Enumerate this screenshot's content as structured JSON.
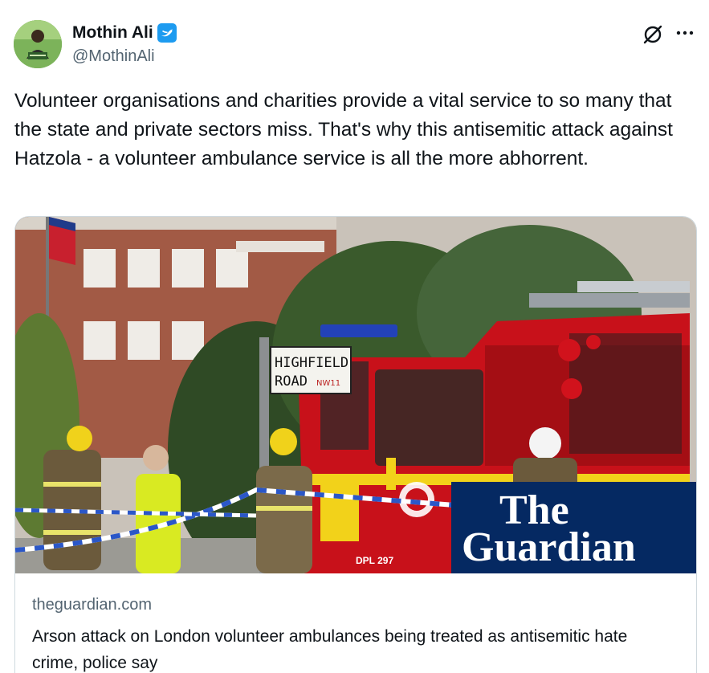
{
  "author": {
    "display_name": "Mothin Ali",
    "handle": "@MothinAli",
    "verified_icon": "verified-badge-icon",
    "avatar_icon": "avatar"
  },
  "actions": {
    "grok_icon": "grok-icon",
    "more_icon": "more-icon"
  },
  "tweet": {
    "text": "Volunteer organisations and charities provide a vital service to so many that the state and private sectors miss. That's why this antisemitic attack against Hatzola - a volunteer ambulance service is all the more abhorrent."
  },
  "link_card": {
    "domain": "theguardian.com",
    "title": "Arson attack on London volunteer ambulances being treated as antisemitic hate crime, police say",
    "image": {
      "street_sign_line1": "HIGHFIELD",
      "street_sign_line2": "ROAD",
      "street_sign_postcode": "NW11",
      "plate": "DPL 297",
      "logo_line1": "The",
      "logo_line2": "Guardian"
    }
  },
  "colors": {
    "text": "#0f1419",
    "secondary": "#536471",
    "verified": "#1d9bf0",
    "border": "#cfd9de",
    "guardian_blue": "#052962"
  }
}
